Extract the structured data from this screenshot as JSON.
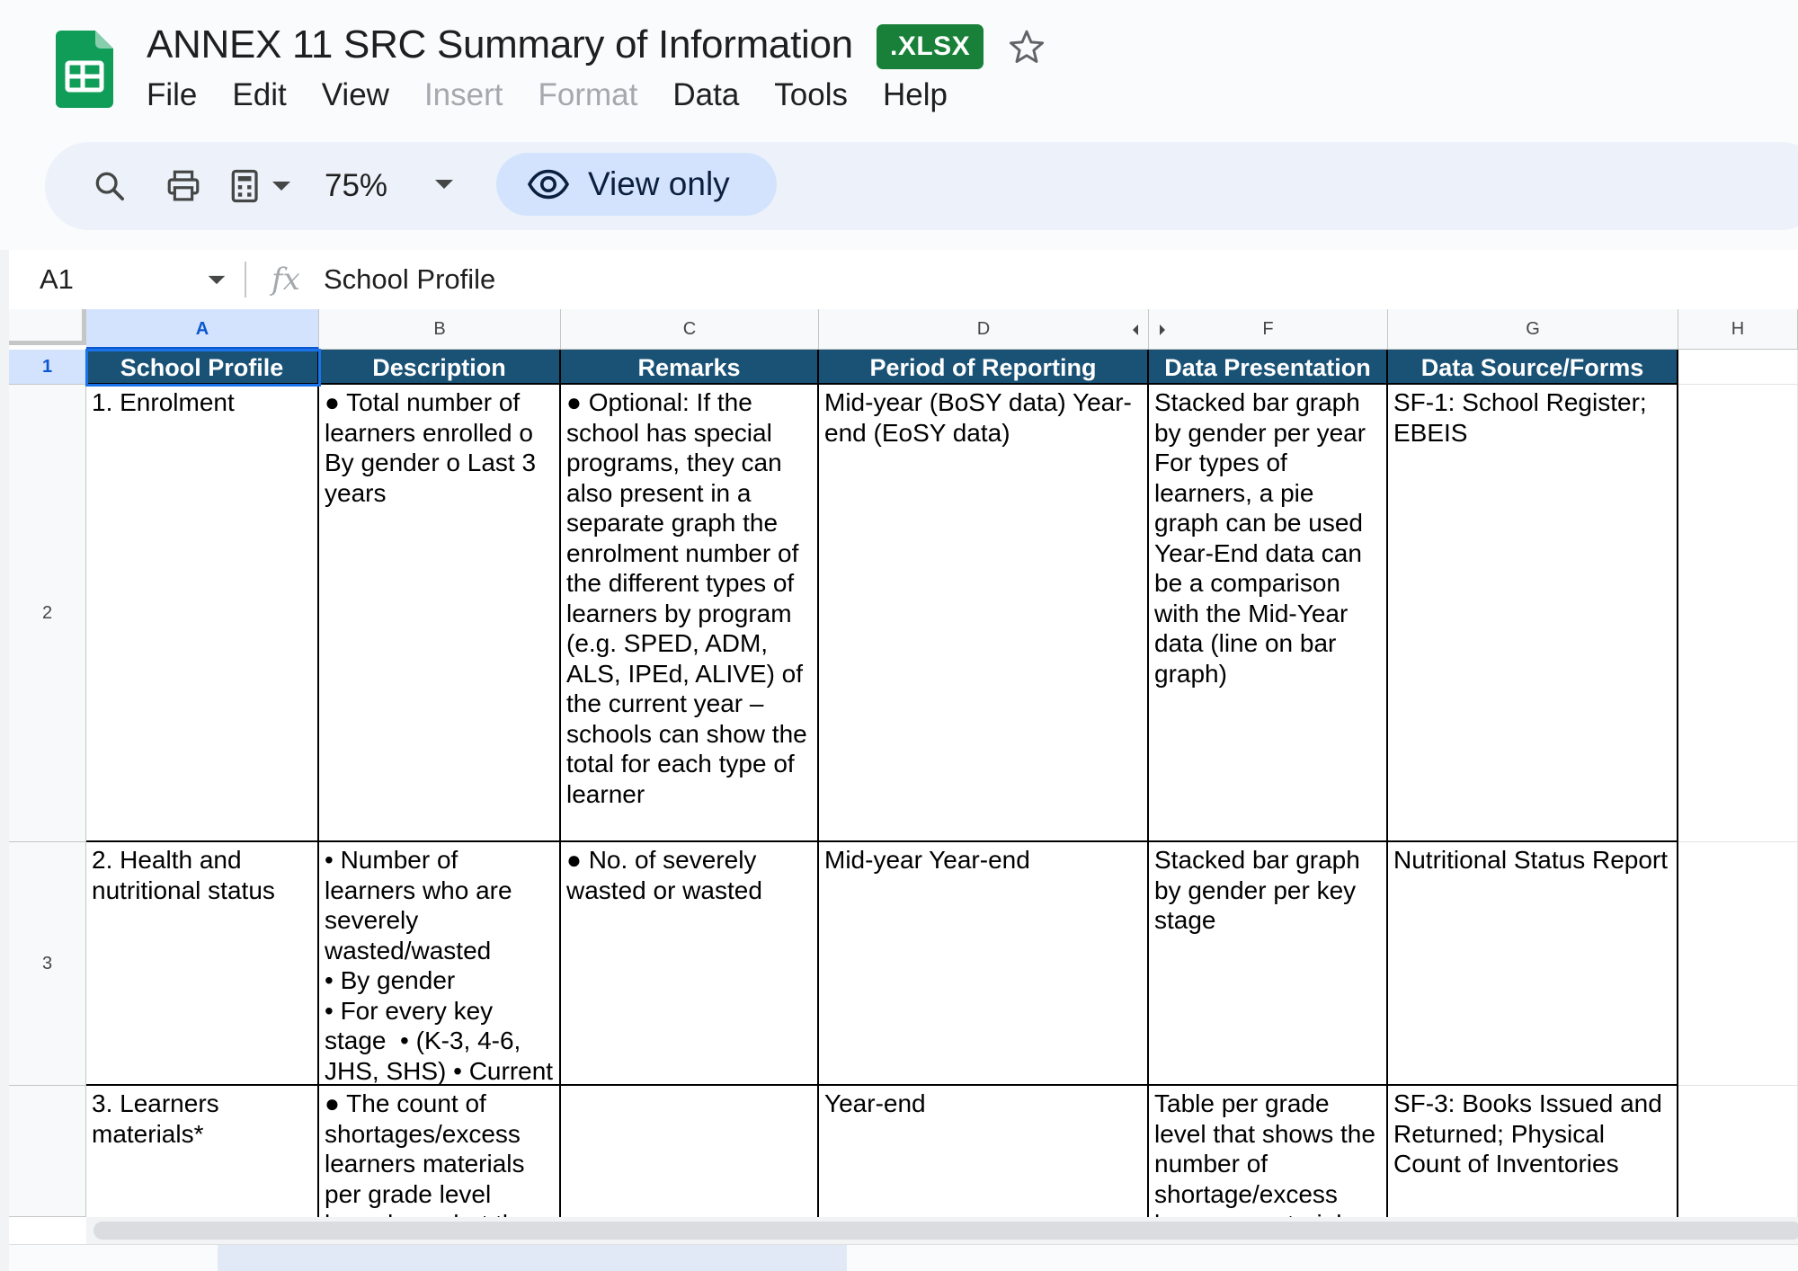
{
  "document": {
    "title": "ANNEX 11 SRC Summary of Information",
    "badge": ".XLSX"
  },
  "menu": [
    "File",
    "Edit",
    "View",
    "Insert",
    "Format",
    "Data",
    "Tools",
    "Help"
  ],
  "menu_disabled": [
    "Insert",
    "Format"
  ],
  "toolbar": {
    "zoom": "75%",
    "view_only_label": "View only"
  },
  "formula_bar": {
    "cell_ref": "A1",
    "fx": "fx",
    "content": "School Profile"
  },
  "columns": [
    "A",
    "B",
    "C",
    "D",
    "F",
    "G",
    "H"
  ],
  "rows": [
    "1",
    "2",
    "3"
  ],
  "header_row": [
    "School Profile",
    "Description",
    "Remarks",
    "Period of Reporting",
    "Data Presentation",
    "Data Source/Forms"
  ],
  "table": [
    [
      "1. Enrolment",
      "● Total number of learners enrolled o By gender o Last 3 years",
      "● Optional: If the school has special programs, they can also present in a separate graph the enrolment number of the different types of learners by program (e.g. SPED, ADM, ALS, IPEd, ALIVE) of the current year – schools can show the total for each type of learner",
      "Mid-year (BoSY data) Year-end (EoSY data)",
      "Stacked bar graph by gender per year For types of learners, a pie graph can be used Year-End data can be a comparison with the Mid-Year data (line on bar graph)",
      "SF-1: School Register; EBEIS"
    ],
    [
      "2. Health and nutritional status",
      "• Number of learners who are severely wasted/wasted\n• By gender\n• For every key stage  • (K-3, 4-6, JHS, SHS) • Current year",
      "● No. of severely wasted or wasted",
      "Mid-year Year-end",
      "Stacked bar graph by gender per key stage",
      "Nutritional Status Report"
    ],
    [
      "3. Learners materials*",
      "● The count of shortages/excess learners materials per grade level based on what the",
      "",
      "Year-end",
      "Table per grade level that shows the number of shortage/excess learners materials",
      "SF-3: Books Issued and Returned; Physical Count of Inventories"
    ]
  ],
  "colors": {
    "header_fill": "#1a5276",
    "header_text": "#ffffff",
    "badge_green": "#188038",
    "view_only_bg": "#d3e3fd",
    "selection": "#1a73e8"
  },
  "icons": [
    "sheets-logo-icon",
    "star-icon",
    "search-icon",
    "print-icon",
    "paint-format-icon",
    "chevron-down-icon",
    "eye-icon",
    "fx-icon"
  ]
}
